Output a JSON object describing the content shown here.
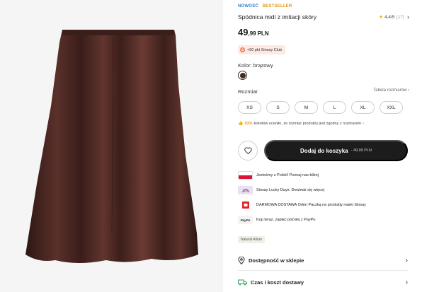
{
  "product": {
    "badge_new": "NOWOŚĆ",
    "badge_bestseller": "BESTSELLER",
    "title": "Spódnica midi z imitacji skóry",
    "rating": "4,4/5",
    "rating_count": "(17)",
    "price_int": "49",
    "price_dec": ",99",
    "price_currency": "PLN"
  },
  "club": {
    "text": "+50 pkt Sinsay Club"
  },
  "color": {
    "label": "Kolor: brązowy",
    "swatch": "#4a2a25"
  },
  "size": {
    "label": "Rozmiar",
    "chart_link": "Tabela rozmiarów",
    "options": [
      "XS",
      "S",
      "M",
      "L",
      "XL",
      "XXL"
    ],
    "fit_percent": "93%",
    "fit_text": "klientów oceniło, że rozmiar produktu jest zgodny z rozmiarem"
  },
  "cart": {
    "label": "Dodaj do koszyka",
    "price": "- 49,99 PLN"
  },
  "perks": [
    {
      "icon": "poland-flag-icon",
      "text": "Jesteśmy z Polski! Poznaj nas bliżej"
    },
    {
      "icon": "lucky-days-icon",
      "text": "Sinsay Lucky Days: Dowiedz się więcej"
    },
    {
      "icon": "delivery-icon",
      "text": "DARMOWA DOSTAWA Orlen Paczką na produkty marki Sinsay"
    },
    {
      "icon": "paypo-icon",
      "icon_text": "PayPo",
      "text": "Kup teraz, zapłać później z PayPo"
    }
  ],
  "collection_tag": "Natural Allure",
  "availability": "Dostępność w sklepie",
  "delivery": "Czas i koszt dostawy",
  "colors": {
    "accent_orange": "#e39a14",
    "blue": "#3b82c4",
    "cart_bg": "#1c1c1c",
    "delivery_green": "#2e9e5b"
  }
}
